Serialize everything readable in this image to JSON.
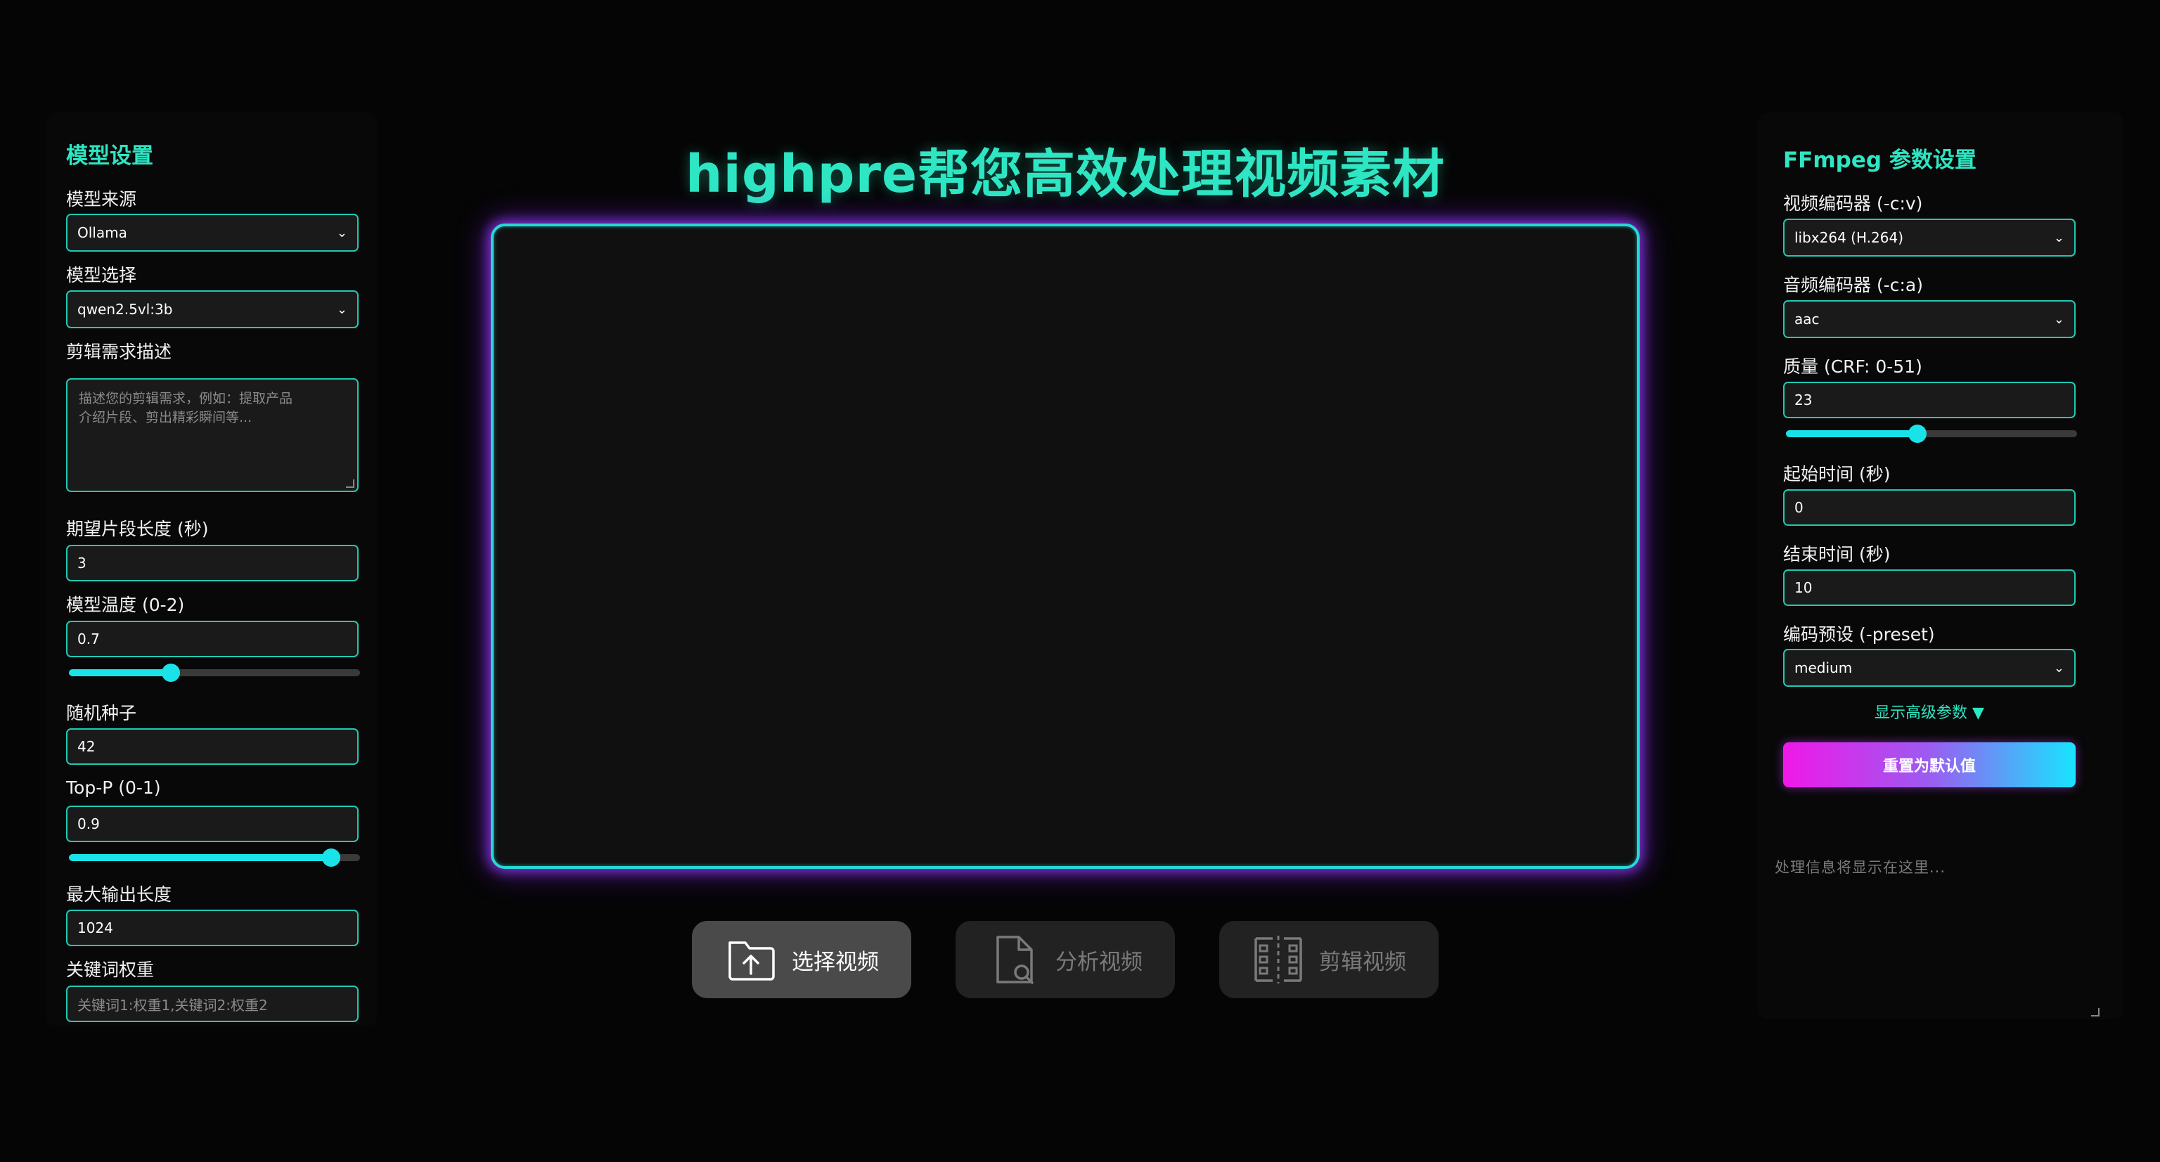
{
  "model_settings": {
    "title": "模型设置",
    "source_label": "模型来源",
    "source_value": "Ollama",
    "model_label": "模型选择",
    "model_value": "qwen2.5vl:3b",
    "desc_label": "剪辑需求描述",
    "desc_placeholder": "描述您的剪辑需求，例如：提取产品\n介绍片段、剪出精彩瞬间等...",
    "segment_label": "期望片段长度 (秒)",
    "segment_value": "3",
    "temp_label": "模型温度 (0-2)",
    "temp_value": "0.7",
    "temp_slider": 0.35,
    "seed_label": "随机种子",
    "seed_value": "42",
    "topp_label": "Top-P (0-1)",
    "topp_value": "0.9",
    "topp_slider": 0.9,
    "maxlen_label": "最大输出长度",
    "maxlen_value": "1024",
    "keyword_label": "关键词权重",
    "keyword_placeholder": "关键词1:权重1,关键词2:权重2"
  },
  "main": {
    "title": "highpre帮您高效处理视频素材",
    "buttons": [
      {
        "label": "选择视频",
        "icon": "folder-upload-icon"
      },
      {
        "label": "分析视频",
        "icon": "file-search-icon"
      },
      {
        "label": "剪辑视频",
        "icon": "film-cut-icon"
      }
    ]
  },
  "ffmpeg": {
    "title": "FFmpeg 参数设置",
    "vcodec_label": "视频编码器 (-c:v)",
    "vcodec_value": "libx264 (H.264)",
    "acodec_label": "音频编码器 (-c:a)",
    "acodec_value": "aac",
    "crf_label": "质量 (CRF: 0-51)",
    "crf_value": "23",
    "crf_slider": 0.451,
    "start_label": "起始时间 (秒)",
    "start_value": "0",
    "end_label": "结束时间 (秒)",
    "end_value": "10",
    "preset_label": "编码预设 (-preset)",
    "preset_value": "medium",
    "advanced_toggle": "显示高级参数 ▼",
    "reset_label": "重置为默认值",
    "log_placeholder": "处理信息将显示在这里..."
  },
  "colors": {
    "accent": "#2ee6c3",
    "border": "#20c9b4",
    "slider": "#19e3e8",
    "glow": "#8c28ff"
  }
}
